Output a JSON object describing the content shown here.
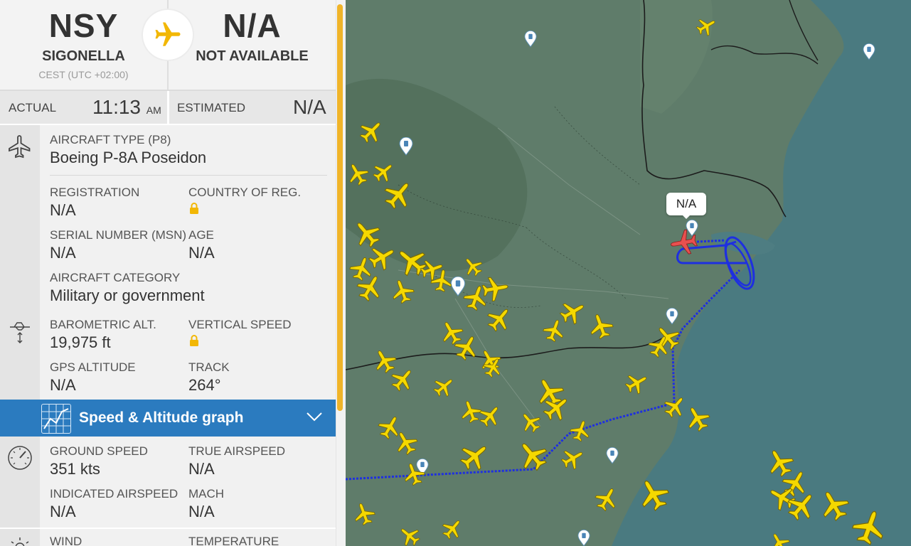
{
  "route": {
    "origin": {
      "code": "NSY",
      "city": "SIGONELLA",
      "timezone": "CEST (UTC +02:00)"
    },
    "destination": {
      "code": "N/A",
      "city": "NOT AVAILABLE"
    }
  },
  "times": {
    "actual_label": "ACTUAL",
    "actual_time": "11:13",
    "actual_ampm": "AM",
    "estimated_label": "ESTIMATED",
    "estimated_time": "N/A"
  },
  "aircraft": {
    "type_label": "AIRCRAFT TYPE",
    "type_code": "(P8)",
    "type_name": "Boeing P-8A Poseidon",
    "registration_label": "REGISTRATION",
    "registration": "N/A",
    "country_label": "COUNTRY OF REG.",
    "serial_label": "SERIAL NUMBER (MSN)",
    "serial": "N/A",
    "age_label": "AGE",
    "age": "N/A",
    "category_label": "AIRCRAFT CATEGORY",
    "category": "Military or government"
  },
  "altitude": {
    "baro_label": "BAROMETRIC ALT.",
    "baro": "19,975 ft",
    "vs_label": "VERTICAL SPEED",
    "gps_label": "GPS ALTITUDE",
    "gps": "N/A",
    "track_label": "TRACK",
    "track": "264°"
  },
  "graph": {
    "label": "Speed & Altitude graph"
  },
  "speed": {
    "gs_label": "GROUND SPEED",
    "gs": "351 kts",
    "tas_label": "TRUE AIRSPEED",
    "tas": "N/A",
    "ias_label": "INDICATED AIRSPEED",
    "ias": "N/A",
    "mach_label": "MACH",
    "mach": "N/A"
  },
  "weather": {
    "wind_label": "WIND",
    "temp_label": "TEMPERATURE"
  },
  "map": {
    "selected_label": "N/A",
    "colors": {
      "land": "#5f7c6a",
      "sea": "#4a7a80",
      "track": "#1e2fe0",
      "selected": "#e8504f",
      "traffic": "#f5d800"
    }
  }
}
